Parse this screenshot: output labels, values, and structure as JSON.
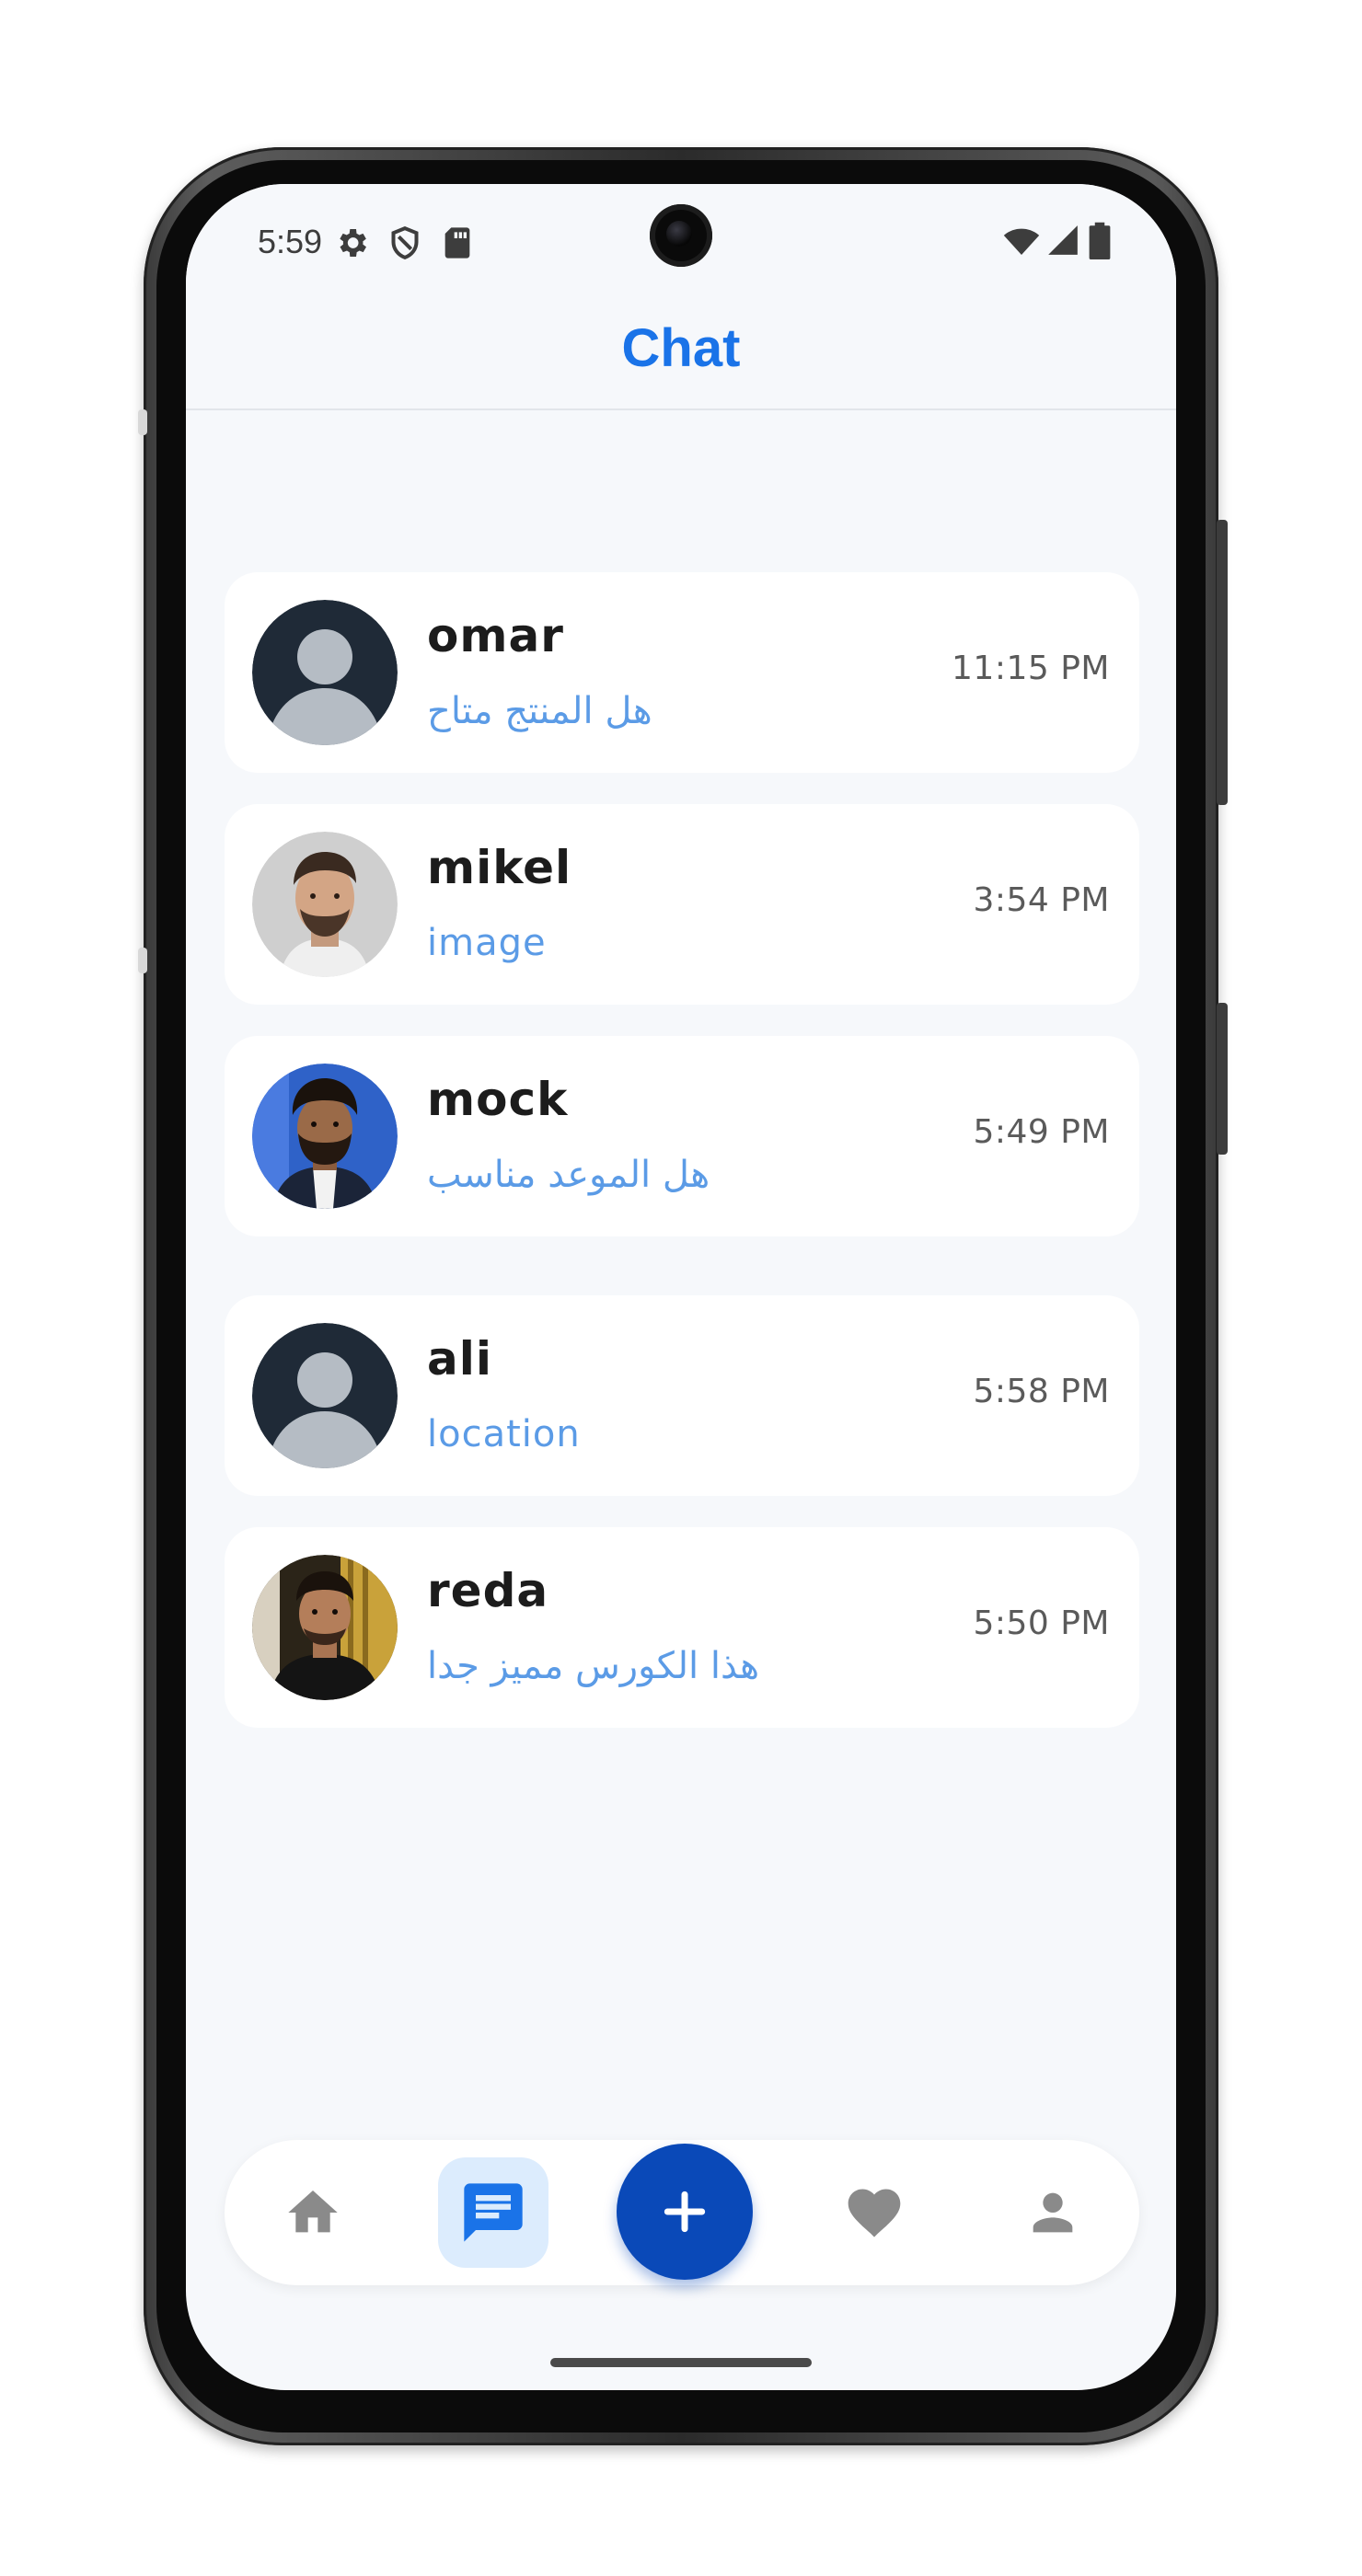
{
  "status_bar": {
    "time": "5:59",
    "icons": [
      "settings-icon",
      "shield-icon",
      "sd-card-icon",
      "wifi-icon",
      "signal-icon",
      "battery-icon"
    ]
  },
  "header": {
    "title": "Chat"
  },
  "chats": [
    {
      "name": "omar",
      "message": "هل المنتج متاح",
      "time": "11:15 PM",
      "avatar": "default-avatar-icon"
    },
    {
      "name": "mikel",
      "message": "image",
      "time": "3:54 PM",
      "avatar": "user-photo"
    },
    {
      "name": "mock",
      "message": "هل الموعد مناسب",
      "time": "5:49 PM",
      "avatar": "user-photo"
    },
    {
      "name": "ali",
      "message": "location",
      "time": "5:58 PM",
      "avatar": "default-avatar-icon"
    },
    {
      "name": "reda",
      "message": "هذا الكورس مميز جدا",
      "time": "5:50 PM",
      "avatar": "user-photo"
    }
  ],
  "bottom_nav": {
    "items": [
      "home-icon",
      "chat-icon",
      "add-icon",
      "heart-icon",
      "profile-icon"
    ],
    "active": "chat-icon"
  },
  "colors": {
    "accent": "#1a73e8",
    "fab": "#0a49b8",
    "message_text": "#5b9be6",
    "background": "#f6f8fb",
    "active_nav_bg": "#dcecfd"
  }
}
